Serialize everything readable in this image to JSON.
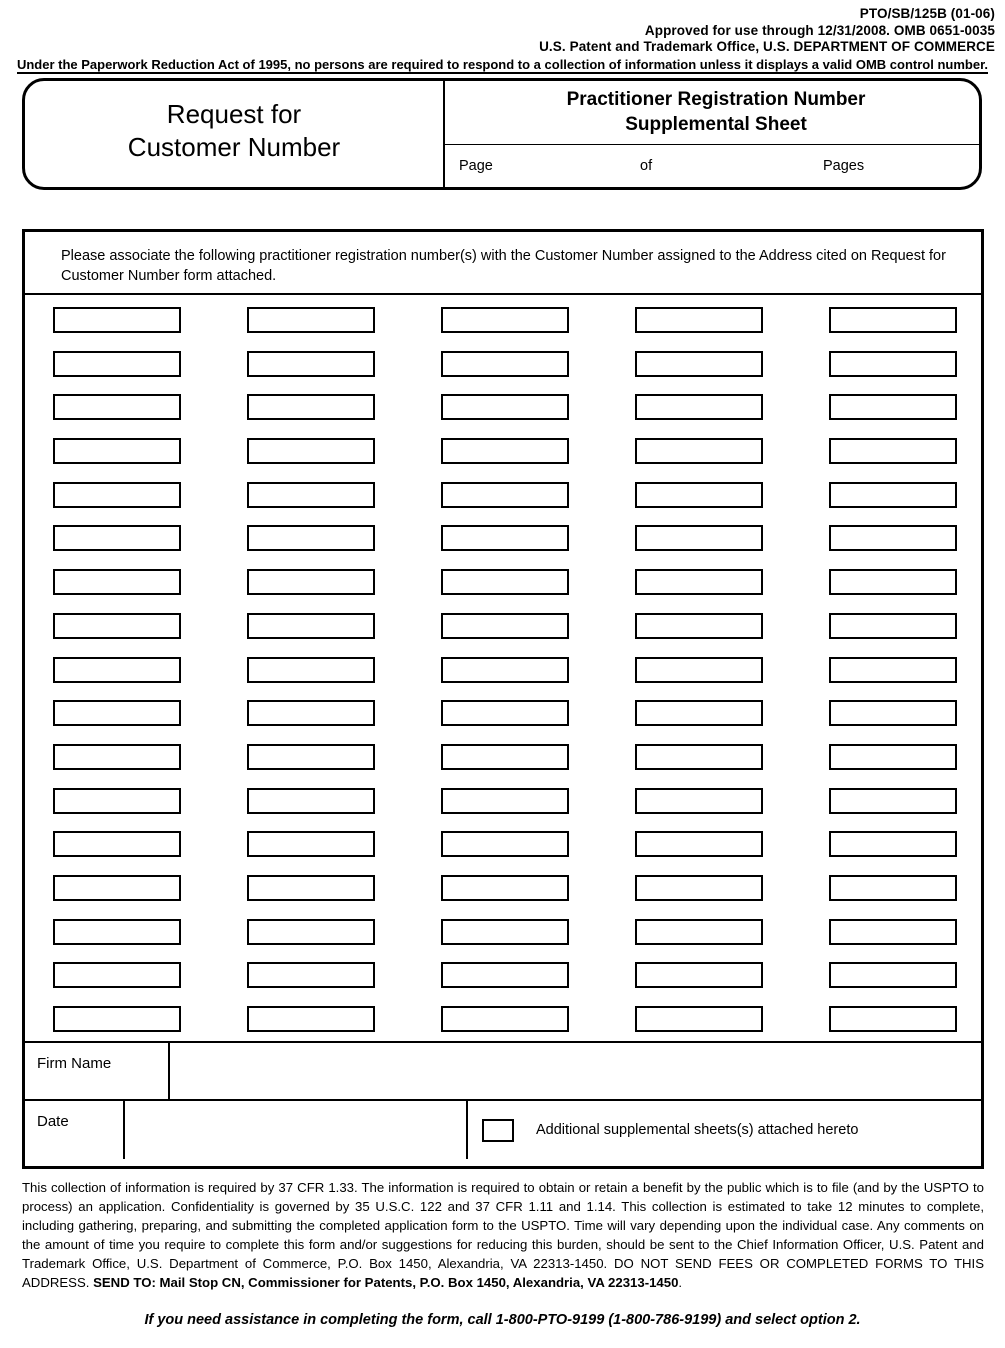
{
  "agency_header": {
    "line1": "PTO/SB/125B (01-06)",
    "line2": "Approved for use through 12/31/2008. OMB 0651-0035",
    "line3": "U.S. Patent and Trademark Office, U.S. DEPARTMENT OF COMMERCE"
  },
  "paperwork_note": "Under the Paperwork Reduction Act of 1995, no persons are required to respond to a collection of information unless it displays a valid OMB control number.",
  "title_box": {
    "left_title": "Request for\nCustomer Number",
    "left_title_line1": "Request for",
    "left_title_line2": "Customer Number",
    "right_title_line1": "Practitioner Registration Number",
    "right_title_line2": "Supplemental Sheet",
    "page_label": "Page",
    "of_label": "of",
    "pages_label": "Pages",
    "page_value": "",
    "pages_value": ""
  },
  "instruction": "Please associate the following practitioner registration number(s) with the Customer Number assigned to the Address cited on Request for Customer Number form attached.",
  "grid": {
    "columns": 5,
    "rows": 17,
    "values": [
      [
        "",
        "",
        "",
        "",
        ""
      ],
      [
        "",
        "",
        "",
        "",
        ""
      ],
      [
        "",
        "",
        "",
        "",
        ""
      ],
      [
        "",
        "",
        "",
        "",
        ""
      ],
      [
        "",
        "",
        "",
        "",
        ""
      ],
      [
        "",
        "",
        "",
        "",
        ""
      ],
      [
        "",
        "",
        "",
        "",
        ""
      ],
      [
        "",
        "",
        "",
        "",
        ""
      ],
      [
        "",
        "",
        "",
        "",
        ""
      ],
      [
        "",
        "",
        "",
        "",
        ""
      ],
      [
        "",
        "",
        "",
        "",
        ""
      ],
      [
        "",
        "",
        "",
        "",
        ""
      ],
      [
        "",
        "",
        "",
        "",
        ""
      ],
      [
        "",
        "",
        "",
        "",
        ""
      ],
      [
        "",
        "",
        "",
        "",
        ""
      ],
      [
        "",
        "",
        "",
        "",
        ""
      ],
      [
        "",
        "",
        "",
        "",
        ""
      ]
    ]
  },
  "firm_row": {
    "label": "Firm Name",
    "value": ""
  },
  "date_row": {
    "label": "Date",
    "value": "",
    "attachment_label": "Additional supplemental sheets(s) attached hereto",
    "attachment_checked": false
  },
  "footer": {
    "part1": "This collection of information is required by 37 CFR 1.33. The information is required to obtain or retain a benefit by the public which is to file (and by the USPTO to process) an application.  Confidentiality is governed by 35 U.S.C. 122 and 37 CFR 1.11 and 1.14.  This collection is estimated to take 12 minutes to complete, including gathering, preparing, and submitting the completed application form to the USPTO.  Time will vary depending upon the individual case.  Any comments on the amount of time you require to complete this form and/or suggestions for reducing this burden, should be sent to the Chief Information Officer, U.S. Patent and Trademark Office, U.S. Department of Commerce, P.O. Box 1450, Alexandria, VA 22313-1450. DO NOT SEND FEES OR COMPLETED FORMS TO THIS ADDRESS.  ",
    "send_to_bold": "SEND TO:  Mail Stop CN, Commissioner for Patents, P.O. Box 1450, Alexandria, VA 22313-1450",
    "part2": "."
  },
  "assistance": "If you need assistance in completing the form, call 1-800-PTO-9199 (1-800-786-9199) and select option 2."
}
